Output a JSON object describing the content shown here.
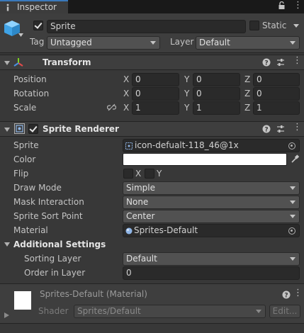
{
  "tab": {
    "label": "Inspector",
    "icon": "info-icon"
  },
  "header": {
    "name": "Sprite",
    "static_label": "Static",
    "tag_label": "Tag",
    "tag_value": "Untagged",
    "layer_label": "Layer",
    "layer_value": "Default"
  },
  "transform": {
    "title": "Transform",
    "rows": [
      {
        "label": "Position",
        "x": "0",
        "y": "0",
        "z": "0"
      },
      {
        "label": "Rotation",
        "x": "0",
        "y": "0",
        "z": "0"
      },
      {
        "label": "Scale",
        "x": "1",
        "y": "1",
        "z": "1"
      }
    ],
    "axis_x": "X",
    "axis_y": "Y",
    "axis_z": "Z"
  },
  "sprite_renderer": {
    "title": "Sprite Renderer",
    "sprite_label": "Sprite",
    "sprite_value": "icon-defualt-118_46@1x",
    "color_label": "Color",
    "color_value": "#ffffff",
    "flip_label": "Flip",
    "flip_x": "X",
    "flip_y": "Y",
    "draw_mode_label": "Draw Mode",
    "draw_mode_value": "Simple",
    "mask_label": "Mask Interaction",
    "mask_value": "None",
    "sort_point_label": "Sprite Sort Point",
    "sort_point_value": "Center",
    "material_label": "Material",
    "material_value": "Sprites-Default",
    "additional_title": "Additional Settings",
    "sorting_layer_label": "Sorting Layer",
    "sorting_layer_value": "Default",
    "order_label": "Order in Layer",
    "order_value": "0"
  },
  "material": {
    "title": "Sprites-Default (Material)",
    "shader_label": "Shader",
    "shader_value": "Sprites/Default",
    "edit_label": "Edit..."
  },
  "colors": {
    "accent": "#3a79bb",
    "background": "#383838",
    "field": "#2a2a2a"
  }
}
